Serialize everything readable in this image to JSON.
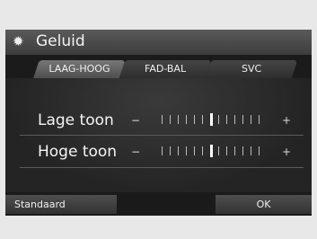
{
  "header": {
    "title": "Geluid",
    "icon": "gear-icon"
  },
  "tabs": [
    {
      "label": "LAAG-HOOG",
      "active": true
    },
    {
      "label": "FAD-BAL",
      "active": false
    },
    {
      "label": "SVC",
      "active": false
    }
  ],
  "settings": [
    {
      "label": "Lage toon",
      "minus": "−",
      "plus": "+",
      "level": 0,
      "min": -6,
      "max": 6
    },
    {
      "label": "Hoge toon",
      "minus": "−",
      "plus": "+",
      "level": 0,
      "min": -6,
      "max": 6
    }
  ],
  "footer": {
    "default_label": "Standaard",
    "ok_label": "OK"
  },
  "colors": {
    "background": "#222222",
    "active_tab": "#6a6a6a",
    "tick": "#bbbbbb",
    "selected_tick": "#ffffff"
  }
}
